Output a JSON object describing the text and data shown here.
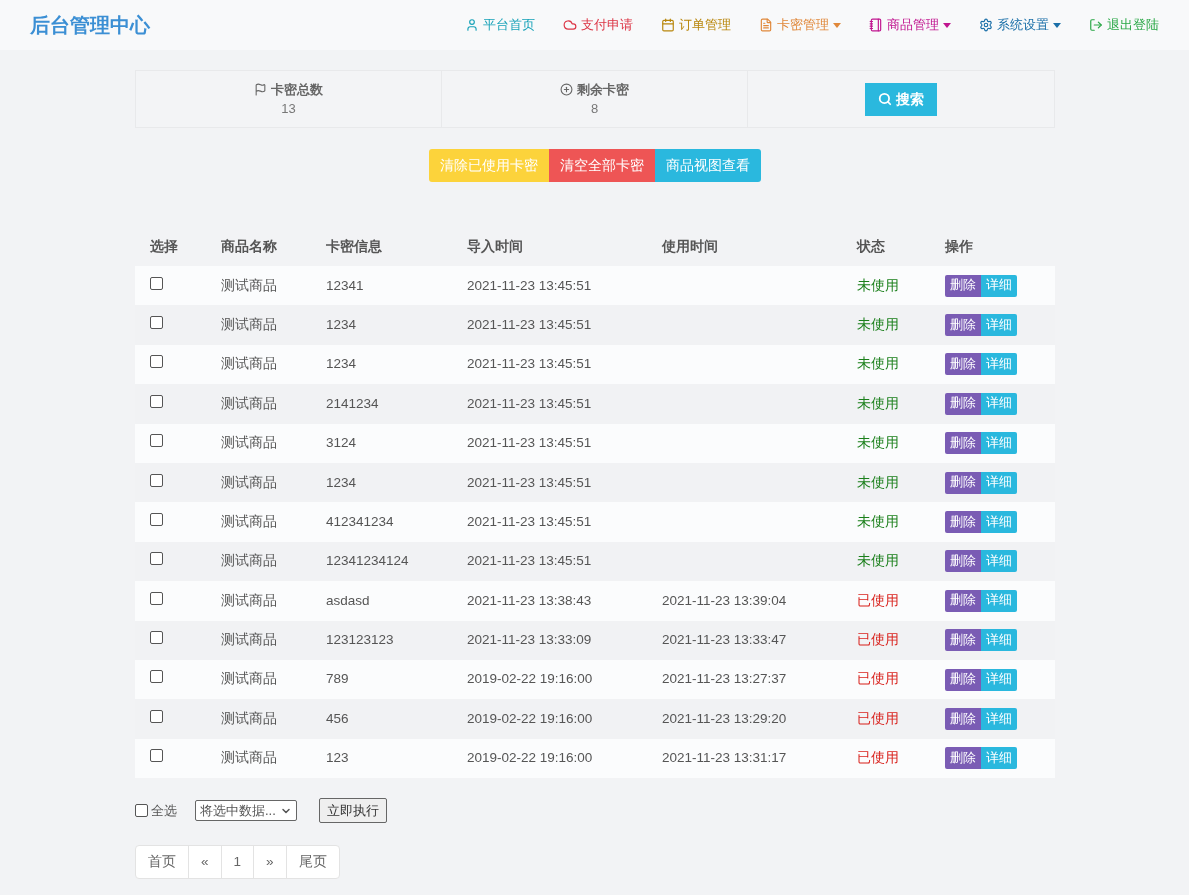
{
  "brand": "后台管理中心",
  "nav": [
    {
      "label": "平台首页",
      "dropdown": false
    },
    {
      "label": "支付申请",
      "dropdown": false
    },
    {
      "label": "订单管理",
      "dropdown": false
    },
    {
      "label": "卡密管理",
      "dropdown": true
    },
    {
      "label": "商品管理",
      "dropdown": true
    },
    {
      "label": "系统设置",
      "dropdown": true
    },
    {
      "label": "退出登陆",
      "dropdown": false
    }
  ],
  "stats": [
    {
      "label": "卡密总数",
      "value": "13"
    },
    {
      "label": "剩余卡密",
      "value": "8"
    }
  ],
  "search_button": "搜索",
  "action_buttons": [
    {
      "label": "清除已使用卡密",
      "kind": "warning"
    },
    {
      "label": "清空全部卡密",
      "kind": "danger"
    },
    {
      "label": "商品视图查看",
      "kind": "info"
    }
  ],
  "table": {
    "columns": [
      "选择",
      "商品名称",
      "卡密信息",
      "导入时间",
      "使用时间",
      "状态",
      "操作"
    ],
    "rows": [
      {
        "checked": false,
        "product": "测试商品",
        "card": "12341",
        "imported": "2021-11-23 13:45:51",
        "used_time": "",
        "status": "未使用",
        "used": false,
        "delete": "删除",
        "detail": "详细"
      },
      {
        "checked": false,
        "product": "测试商品",
        "card": "1234",
        "imported": "2021-11-23 13:45:51",
        "used_time": "",
        "status": "未使用",
        "used": false,
        "delete": "删除",
        "detail": "详细"
      },
      {
        "checked": false,
        "product": "测试商品",
        "card": "1234",
        "imported": "2021-11-23 13:45:51",
        "used_time": "",
        "status": "未使用",
        "used": false,
        "delete": "删除",
        "detail": "详细"
      },
      {
        "checked": false,
        "product": "测试商品",
        "card": "2141234",
        "imported": "2021-11-23 13:45:51",
        "used_time": "",
        "status": "未使用",
        "used": false,
        "delete": "删除",
        "detail": "详细"
      },
      {
        "checked": false,
        "product": "测试商品",
        "card": "3124",
        "imported": "2021-11-23 13:45:51",
        "used_time": "",
        "status": "未使用",
        "used": false,
        "delete": "删除",
        "detail": "详细"
      },
      {
        "checked": false,
        "product": "测试商品",
        "card": "1234",
        "imported": "2021-11-23 13:45:51",
        "used_time": "",
        "status": "未使用",
        "used": false,
        "delete": "删除",
        "detail": "详细"
      },
      {
        "checked": false,
        "product": "测试商品",
        "card": "412341234",
        "imported": "2021-11-23 13:45:51",
        "used_time": "",
        "status": "未使用",
        "used": false,
        "delete": "删除",
        "detail": "详细"
      },
      {
        "checked": false,
        "product": "测试商品",
        "card": "12341234124",
        "imported": "2021-11-23 13:45:51",
        "used_time": "",
        "status": "未使用",
        "used": false,
        "delete": "删除",
        "detail": "详细"
      },
      {
        "checked": false,
        "product": "测试商品",
        "card": "asdasd",
        "imported": "2021-11-23 13:38:43",
        "used_time": "2021-11-23 13:39:04",
        "status": "已使用",
        "used": true,
        "delete": "删除",
        "detail": "详细"
      },
      {
        "checked": false,
        "product": "测试商品",
        "card": "123123123",
        "imported": "2021-11-23 13:33:09",
        "used_time": "2021-11-23 13:33:47",
        "status": "已使用",
        "used": true,
        "delete": "删除",
        "detail": "详细"
      },
      {
        "checked": false,
        "product": "测试商品",
        "card": "789",
        "imported": "2019-02-22 19:16:00",
        "used_time": "2021-11-23 13:27:37",
        "status": "已使用",
        "used": true,
        "delete": "删除",
        "detail": "详细"
      },
      {
        "checked": false,
        "product": "测试商品",
        "card": "456",
        "imported": "2019-02-22 19:16:00",
        "used_time": "2021-11-23 13:29:20",
        "status": "已使用",
        "used": true,
        "delete": "删除",
        "detail": "详细"
      },
      {
        "checked": false,
        "product": "测试商品",
        "card": "123",
        "imported": "2019-02-22 19:16:00",
        "used_time": "2021-11-23 13:31:17",
        "status": "已使用",
        "used": true,
        "delete": "删除",
        "detail": "详细"
      }
    ]
  },
  "bulk": {
    "select_all": {
      "label": "全选",
      "checked": false
    },
    "action_select": "将选中数据...",
    "execute": "立即执行"
  },
  "pagination": [
    "首页",
    "«",
    "1",
    "»",
    "尾页"
  ]
}
